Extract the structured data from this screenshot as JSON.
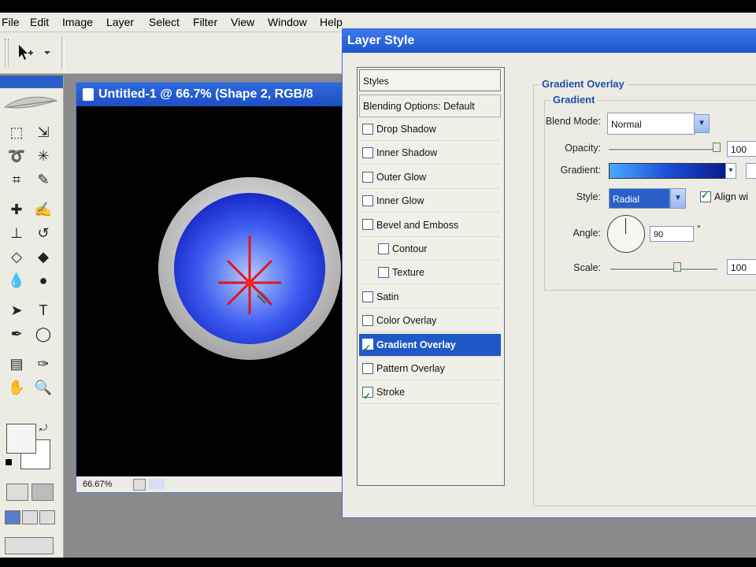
{
  "menu": [
    "File",
    "Edit",
    "Image",
    "Layer",
    "Select",
    "Filter",
    "View",
    "Window",
    "Help"
  ],
  "document": {
    "title": "Untitled-1 @ 66.7% (Shape 2, RGB/8",
    "zoom": "66.67%"
  },
  "dialog": {
    "title": "Layer Style",
    "list_header": "Styles",
    "blending": "Blending Options: Default",
    "items": [
      {
        "label": "Drop Shadow",
        "checked": false,
        "indent": false,
        "active": false
      },
      {
        "label": "Inner Shadow",
        "checked": false,
        "indent": false,
        "active": false
      },
      {
        "label": "Outer Glow",
        "checked": false,
        "indent": false,
        "active": false
      },
      {
        "label": "Inner Glow",
        "checked": false,
        "indent": false,
        "active": false
      },
      {
        "label": "Bevel and Emboss",
        "checked": false,
        "indent": false,
        "active": false
      },
      {
        "label": "Contour",
        "checked": false,
        "indent": true,
        "active": false
      },
      {
        "label": "Texture",
        "checked": false,
        "indent": true,
        "active": false
      },
      {
        "label": "Satin",
        "checked": false,
        "indent": false,
        "active": false
      },
      {
        "label": "Color Overlay",
        "checked": false,
        "indent": false,
        "active": false
      },
      {
        "label": "Gradient Overlay",
        "checked": true,
        "indent": false,
        "active": true
      },
      {
        "label": "Pattern Overlay",
        "checked": false,
        "indent": false,
        "active": false
      },
      {
        "label": "Stroke",
        "checked": true,
        "indent": false,
        "active": false
      }
    ],
    "panel": {
      "section_title": "Gradient Overlay",
      "sub_title": "Gradient",
      "blend_mode_label": "Blend Mode:",
      "blend_mode_value": "Normal",
      "opacity_label": "Opacity:",
      "opacity_value": "100",
      "gradient_label": "Gradient:",
      "style_label": "Style:",
      "style_value": "Radial",
      "align_label": "Align wi",
      "align_checked": true,
      "angle_label": "Angle:",
      "angle_value": "90",
      "angle_unit": "°",
      "scale_label": "Scale:",
      "scale_value": "100"
    }
  },
  "colors": {
    "title_bar": "#2a5fc7",
    "selected_item": "#1f58c7",
    "canvas_bg": "#000000",
    "button_inner": "#1727c7",
    "star_red": "#e01818"
  }
}
